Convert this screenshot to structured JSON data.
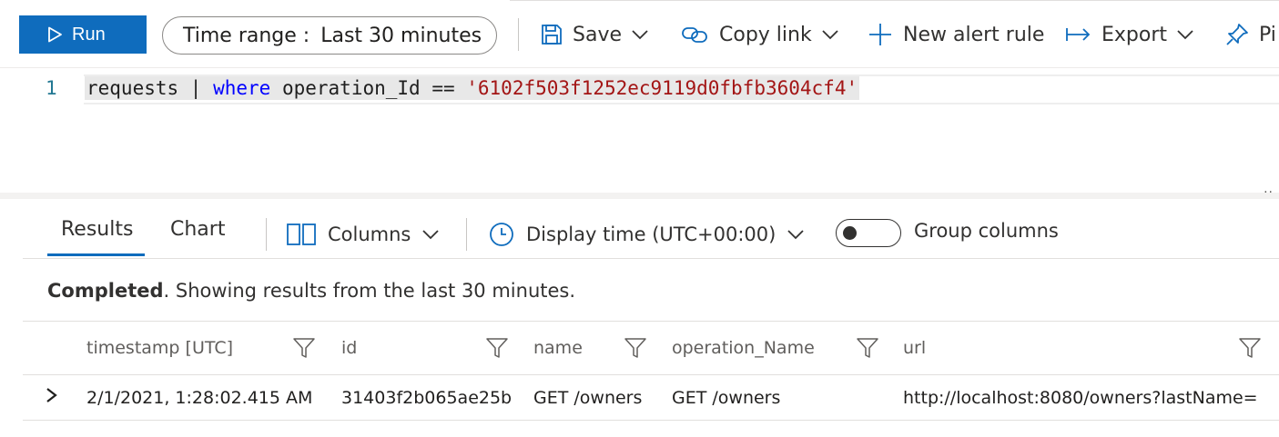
{
  "toolbar": {
    "run_label": "Run",
    "time_range_label": "Time range :",
    "time_range_value": "Last 30 minutes",
    "save_label": "Save",
    "copy_link_label": "Copy link",
    "new_alert_label": "New alert rule",
    "export_label": "Export",
    "pin_label": "Pi"
  },
  "editor": {
    "line_number": "1",
    "code_table": "requests",
    "code_pipe": " | ",
    "code_keyword": "where",
    "code_middle": " operation_Id == ",
    "code_string": "'6102f503f1252ec9119d0fbfb3604cf4'"
  },
  "splitter_dots": "..",
  "results": {
    "tabs": [
      {
        "label": "Results"
      },
      {
        "label": "Chart"
      }
    ],
    "columns_label": "Columns",
    "display_time_label": "Display time (UTC+00:00)",
    "group_columns_label": "Group columns",
    "status_bold": "Completed",
    "status_rest": ". Showing results from the last 30 minutes."
  },
  "table": {
    "headers": [
      "timestamp [UTC]",
      "id",
      "name",
      "operation_Name",
      "url"
    ],
    "rows": [
      [
        "2/1/2021, 1:28:02.415 AM",
        "31403f2b065ae25b",
        "GET /owners",
        "GET /owners",
        "http://localhost:8080/owners?lastName="
      ]
    ]
  },
  "colors": {
    "accent": "#0f6cbd",
    "string": "#a31515",
    "keyword": "#0000ff",
    "line_number": "#237893"
  }
}
